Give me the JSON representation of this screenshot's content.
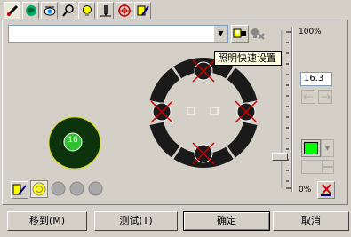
{
  "tabs": [
    {
      "name": "brush-tab-icon"
    },
    {
      "name": "globe-tab-icon"
    },
    {
      "name": "eye-tab-icon"
    },
    {
      "name": "magnifier-tab-icon"
    },
    {
      "name": "bulb-tab-icon"
    },
    {
      "name": "pen-tab-icon"
    },
    {
      "name": "target-tab-icon"
    },
    {
      "name": "edit-light-tab-icon"
    }
  ],
  "preset": {
    "value": ""
  },
  "tooltip": {
    "text": "照明快速设置"
  },
  "slider": {
    "top_label": "100%",
    "bottom_label": "0%",
    "level_fraction": 0.2
  },
  "spot_size": {
    "value": "16.3"
  },
  "spot": {
    "label": "16"
  },
  "color": {
    "swatch": "#00ff00"
  },
  "buttons": {
    "move_to": "移到(M)",
    "test": "测试(T)",
    "ok": "确定",
    "cancel": "取消"
  }
}
